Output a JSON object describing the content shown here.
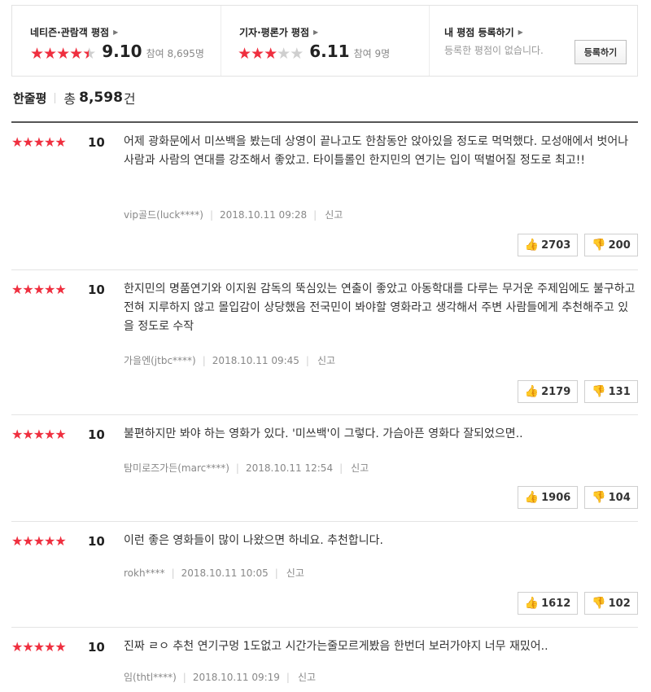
{
  "ratings": {
    "netizen": {
      "title": "네티즌·관람객 평점",
      "score": "9.10",
      "participants": "참여 8,695명",
      "stars": 4.5
    },
    "critic": {
      "title": "기자·평론가 평점",
      "score": "6.11",
      "participants": "참여 9명",
      "stars": 3
    },
    "mine": {
      "title": "내 평점 등록하기",
      "empty_text": "등록한 평점이 없습니다.",
      "button_label": "등록하기"
    }
  },
  "review_header": {
    "label": "한줄평",
    "total_prefix": "총",
    "count": "8,598",
    "unit": "건"
  },
  "reviews": [
    {
      "stars": 5,
      "score": "10",
      "text": "어제 광화문에서 미쓰백을 봤는데 상영이 끝나고도 한참동안 앉아있을 정도로 먹먹했다. 모성애에서 벗어나 사람과 사람의 연대를 강조해서 좋았고. 타이틀롤인 한지민의 연기는 입이 떡벌어질 정도로 최고!!",
      "user": "vip골드(luck****)",
      "date": "2018.10.11 09:28",
      "report": "신고",
      "likes": "2703",
      "dislikes": "200"
    },
    {
      "stars": 5,
      "score": "10",
      "text": "한지민의 명품연기와 이지원 감독의 뚝심있는 연출이 좋았고 아동학대를 다루는 무거운 주제임에도 불구하고 전혀 지루하지 않고 몰입감이 상당했음 전국민이 봐야할 영화라고 생각해서 주변 사람들에게 추천해주고 있을 정도로 수작",
      "user": "가을엔(jtbc****)",
      "date": "2018.10.11 09:45",
      "report": "신고",
      "likes": "2179",
      "dislikes": "131"
    },
    {
      "stars": 5,
      "score": "10",
      "text": "불편하지만 봐야 하는 영화가 있다. '미쓰백'이 그렇다. 가슴아픈 영화다 잘되었으면..",
      "user": "탐미로즈가든(marc****)",
      "date": "2018.10.11 12:54",
      "report": "신고",
      "likes": "1906",
      "dislikes": "104"
    },
    {
      "stars": 5,
      "score": "10",
      "text": "이런 좋은 영화들이 많이 나왔으면 하네요. 추천합니다.",
      "user": "rokh****",
      "date": "2018.10.11 10:05",
      "report": "신고",
      "likes": "1612",
      "dislikes": "102"
    },
    {
      "stars": 5,
      "score": "10",
      "text": "진짜 ㄹㅇ 추천 연기구멍 1도없고 시간가는줄모르게봤음 한번더 보러가야지 너무 재밌어..",
      "user": "임(thtl****)",
      "date": "2018.10.11 09:19",
      "report": "신고"
    }
  ]
}
